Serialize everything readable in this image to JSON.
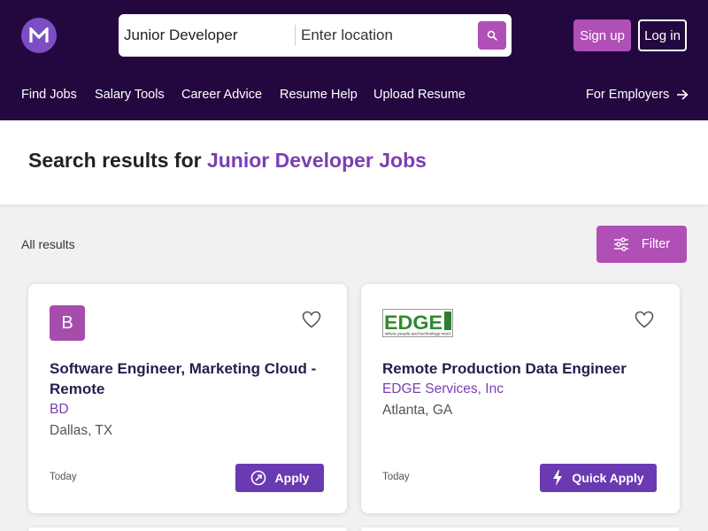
{
  "header": {
    "logo_letter": "M",
    "search": {
      "keyword_value": "Junior Developer",
      "location_placeholder": "Enter location"
    },
    "signup_label": "Sign up",
    "login_label": "Log in",
    "nav": [
      "Find Jobs",
      "Salary Tools",
      "Career Advice",
      "Resume Help",
      "Upload Resume"
    ],
    "employers_label": "For Employers"
  },
  "results": {
    "title_prefix": "Search results for ",
    "title_keyword": "Junior Developer Jobs",
    "all_results_label": "All results",
    "filter_label": "Filter"
  },
  "jobs": [
    {
      "logo_letter": "B",
      "title": "Software Engineer, Marketing Cloud - Remote",
      "company": "BD",
      "location": "Dallas, TX",
      "posted": "Today",
      "apply_label": "Apply"
    },
    {
      "logo_text": "EDGE",
      "logo_tagline": "where people and technology meet",
      "title": "Remote Production Data Engineer",
      "company": "EDGE Services, Inc",
      "location": "Atlanta, GA",
      "posted": "Today",
      "apply_label": "Quick Apply"
    }
  ],
  "colors": {
    "header_bg": "#23083f",
    "accent_pink": "#b04fb5",
    "accent_purple": "#6a3ab2",
    "keyword_purple": "#7a3fb0"
  },
  "icons": [
    "search-icon",
    "heart-icon",
    "external-link-icon",
    "lightning-icon",
    "sliders-icon",
    "arrow-right-icon"
  ]
}
